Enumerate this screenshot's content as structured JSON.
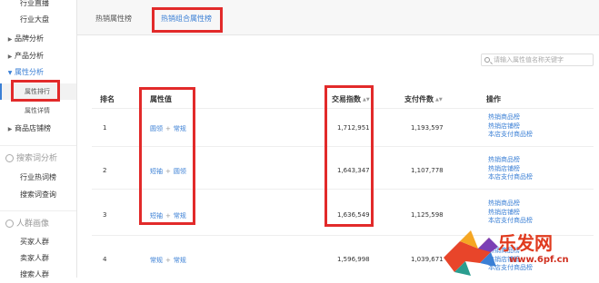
{
  "sidebar": {
    "top_items": [
      "行业直播",
      "行业大盘"
    ],
    "collapsed_items": [
      "品牌分析",
      "产品分析"
    ],
    "open_item": "属性分析",
    "sub_items": [
      "属性排行",
      "属性详情"
    ],
    "shop_item": "商品店铺榜",
    "search_section": "搜索词分析",
    "search_items": [
      "行业热词榜",
      "搜索词查询"
    ],
    "crowd_section": "人群画像",
    "crowd_items": [
      "买家人群",
      "卖家人群",
      "搜索人群"
    ]
  },
  "tabs": [
    "热销属性榜",
    "热销组合属性榜"
  ],
  "search": {
    "placeholder": "请输入属性值名称关键字"
  },
  "table": {
    "headers": [
      "排名",
      "属性值",
      "交易指数",
      "支付件数",
      "操作"
    ],
    "rows": [
      {
        "rank": "1",
        "attrs": [
          "圆领",
          "常规"
        ],
        "trade": "1,712,951",
        "paid": "1,193,597",
        "ops": [
          "热销商品榜",
          "热销店铺榜",
          "本店支付商品榜"
        ]
      },
      {
        "rank": "2",
        "attrs": [
          "短袖",
          "圆领"
        ],
        "trade": "1,643,347",
        "paid": "1,107,778",
        "ops": [
          "热销商品榜",
          "热销店铺榜",
          "本店支付商品榜"
        ]
      },
      {
        "rank": "3",
        "attrs": [
          "短袖",
          "常规"
        ],
        "trade": "1,636,549",
        "paid": "1,125,598",
        "ops": [
          "热销商品榜",
          "热销店铺榜",
          "本店支付商品榜"
        ]
      },
      {
        "rank": "4",
        "attrs": [
          "常规",
          "常规"
        ],
        "trade": "1,596,998",
        "paid": "1,039,671",
        "ops": [
          "热销商品榜",
          "热销店铺榜",
          "本店支付商品榜"
        ]
      }
    ]
  },
  "watermark": {
    "text": "乐发网",
    "url": "www.6pf.cn"
  },
  "colors": {
    "accent": "#3a7fd5",
    "highlight": "#e22a2a"
  }
}
